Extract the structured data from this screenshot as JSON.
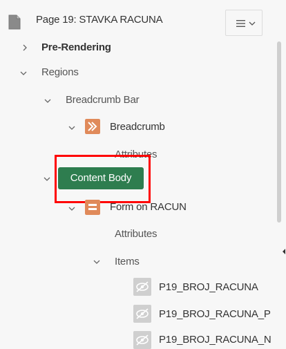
{
  "header": {
    "title": "Page 19: STAVKA RACUNA",
    "page_icon": "page-icon",
    "menu_icon": "hamburger-menu-icon",
    "menu_chevron": "chevron-down-icon"
  },
  "tree": {
    "pre_rendering": "Pre-Rendering",
    "regions": "Regions",
    "breadcrumb_bar": "Breadcrumb Bar",
    "breadcrumb": "Breadcrumb",
    "breadcrumb_attributes": "Attributes",
    "content_body": "Content Body",
    "form_on_racun": "Form on RACUN",
    "form_attributes": "Attributes",
    "items": "Items",
    "item_list": [
      "P19_BROJ_RACUNA",
      "P19_BROJ_RACUNA_P",
      "P19_BROJ_RACUNA_N"
    ]
  },
  "colors": {
    "content_body_badge": "#2e7d4f",
    "region_icon": "#e08a5a",
    "highlight": "#ff0000"
  }
}
